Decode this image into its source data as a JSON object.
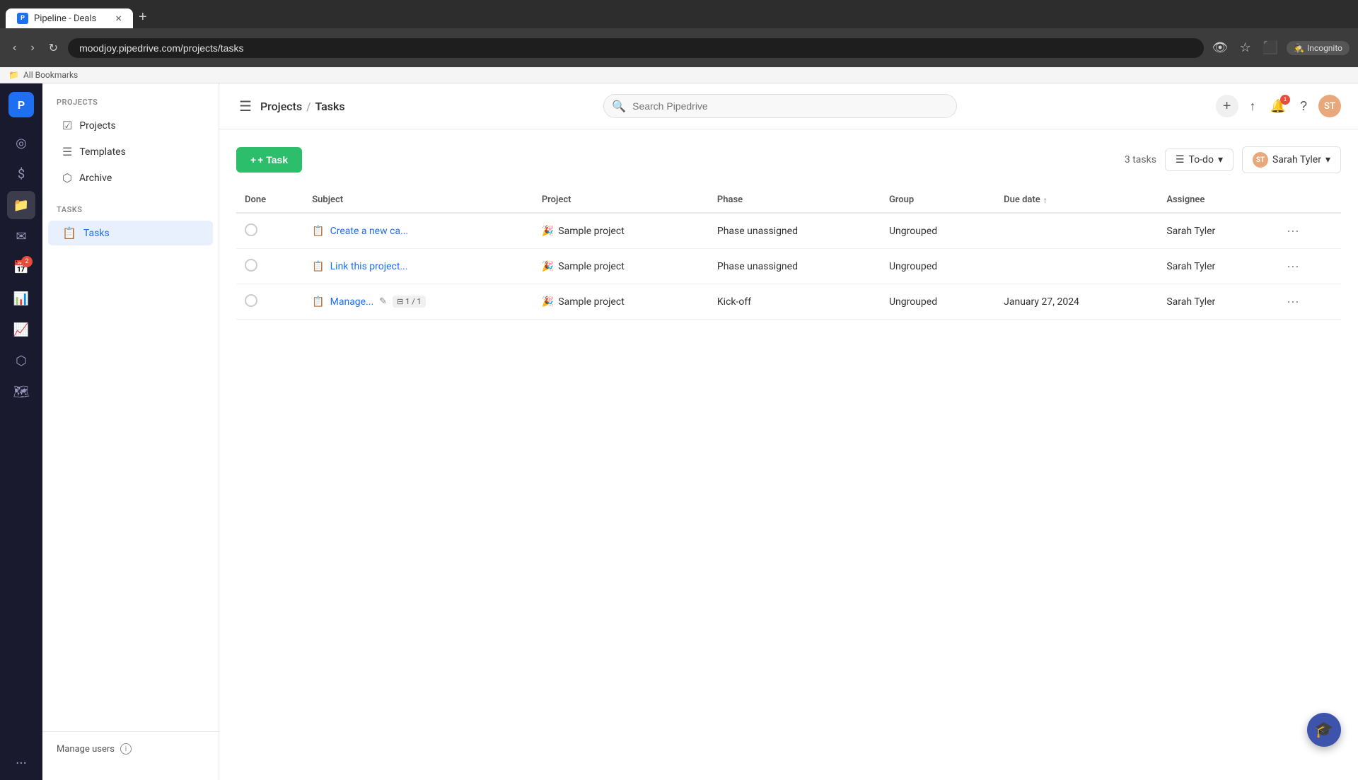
{
  "browser": {
    "tab_title": "Pipeline - Deals",
    "tab_icon": "P",
    "address": "moodjoy.pipedrive.com/projects/tasks",
    "incognito_label": "Incognito",
    "bookmarks_label": "All Bookmarks"
  },
  "header": {
    "menu_icon": "☰",
    "breadcrumb_parent": "Projects",
    "breadcrumb_sep": "/",
    "breadcrumb_current": "Tasks",
    "search_placeholder": "Search Pipedrive",
    "plus_label": "+",
    "avatar_initials": "ST"
  },
  "sidebar": {
    "projects_section": "PROJECTS",
    "tasks_section": "TASKS",
    "items_projects": [
      {
        "label": "Projects",
        "icon": "☑"
      },
      {
        "label": "Templates",
        "icon": "☰"
      },
      {
        "label": "Archive",
        "icon": "⬡"
      }
    ],
    "items_tasks": [
      {
        "label": "Tasks",
        "icon": "📋",
        "active": true
      }
    ],
    "manage_users_label": "Manage users"
  },
  "content": {
    "add_task_label": "+ Task",
    "tasks_count": "3 tasks",
    "filter_label": "To-do",
    "assignee_filter_label": "Sarah Tyler",
    "assignee_initials": "ST",
    "table": {
      "columns": [
        "Done",
        "Subject",
        "Project",
        "Phase",
        "Group",
        "Due date",
        "Assignee"
      ],
      "rows": [
        {
          "done": false,
          "subject": "Create a new ca...",
          "subject_icon": "📋",
          "project": "Sample project",
          "project_emoji": "🎉",
          "phase": "Phase unassigned",
          "group": "Ungrouped",
          "due_date": "",
          "assignee": "Sarah Tyler"
        },
        {
          "done": false,
          "subject": "Link this project...",
          "subject_icon": "📋",
          "project": "Sample project",
          "project_emoji": "🎉",
          "phase": "Phase unassigned",
          "group": "Ungrouped",
          "due_date": "",
          "assignee": "Sarah Tyler"
        },
        {
          "done": false,
          "subject": "Manage...",
          "subject_icon": "📋",
          "has_subtask": true,
          "subtask_label": "1 / 1",
          "project": "Sample project",
          "project_emoji": "🎉",
          "phase": "Kick-off",
          "group": "Ungrouped",
          "due_date": "January 27, 2024",
          "assignee": "Sarah Tyler"
        }
      ]
    }
  },
  "icons": {
    "menu": "☰",
    "search": "🔍",
    "plus": "+",
    "bell": "🔔",
    "help": "?",
    "bookmark": "⭐",
    "share": "↑",
    "eye_off": "👁",
    "incognito": "🕵",
    "chevron_down": "▾",
    "sort_asc": "↑",
    "more": "···",
    "hat": "🎓",
    "nav_target": "◎",
    "nav_money": "$",
    "nav_projects": "📁",
    "nav_mail": "✉",
    "nav_calendar": "📅",
    "nav_chart": "📊",
    "nav_trend": "📈",
    "nav_cube": "⬡",
    "nav_map": "🗺",
    "notif_count": "1",
    "calendar_badge": "2"
  }
}
